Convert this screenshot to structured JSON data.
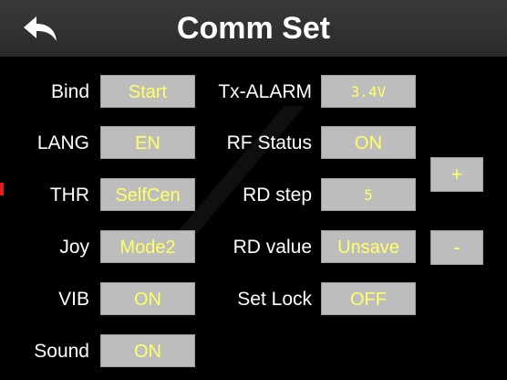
{
  "header": {
    "title": "Comm Set",
    "back_icon": "back-arrow-icon"
  },
  "rows": [
    {
      "left_label": "Bind",
      "left_value": "Start",
      "right_label": "Tx-ALARM",
      "right_value": "3.4V"
    },
    {
      "left_label": "LANG",
      "left_value": "EN",
      "right_label": "RF Status",
      "right_value": "ON"
    },
    {
      "left_label": "THR",
      "left_value": "SelfCen",
      "right_label": "RD step",
      "right_value": "5"
    },
    {
      "left_label": "Joy",
      "left_value": "Mode2",
      "right_label": "RD value",
      "right_value": "Unsave"
    },
    {
      "left_label": "VIB",
      "left_value": "ON",
      "right_label": "Set Lock",
      "right_value": "OFF"
    },
    {
      "left_label": "Sound",
      "left_value": "ON"
    }
  ],
  "controls": {
    "plus_label": "+",
    "minus_label": "-"
  },
  "colors": {
    "background": "#000000",
    "header": "#2f2f2f",
    "button": "#bdbdbd",
    "value_text": "#ffff66",
    "label_text": "#ffffff"
  }
}
